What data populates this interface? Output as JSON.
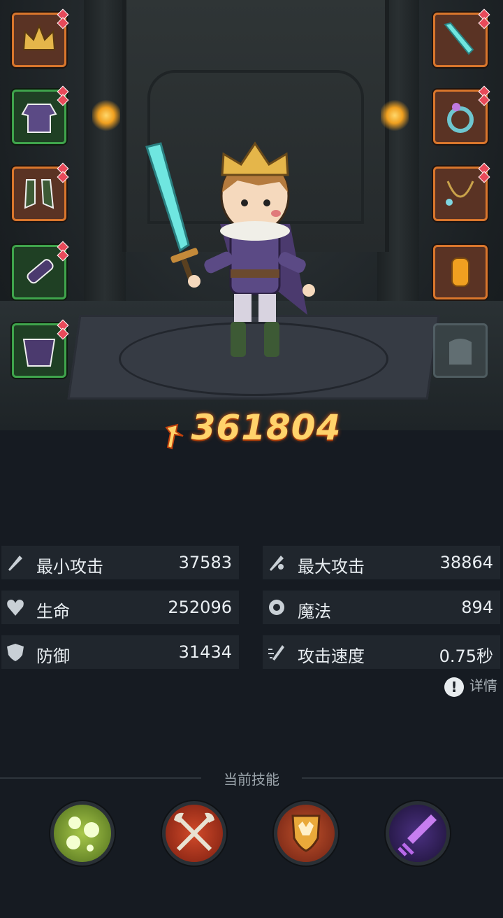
{
  "power": {
    "value": "361804",
    "icon": "sword-power-icon"
  },
  "equipment": {
    "left": [
      {
        "name": "helmet-slot",
        "icon": "crown-helmet-icon",
        "rarity": "orange"
      },
      {
        "name": "armor-slot",
        "icon": "tunic-armor-icon",
        "rarity": "green"
      },
      {
        "name": "boots-slot",
        "icon": "boots-icon",
        "rarity": "orange"
      },
      {
        "name": "gloves-slot",
        "icon": "bracer-icon",
        "rarity": "green"
      },
      {
        "name": "cape-slot",
        "icon": "cape-icon",
        "rarity": "green"
      }
    ],
    "right": [
      {
        "name": "weapon-slot",
        "icon": "crystal-sword-icon",
        "rarity": "orange"
      },
      {
        "name": "ring-slot",
        "icon": "ring-icon",
        "rarity": "orange"
      },
      {
        "name": "necklace-slot",
        "icon": "necklace-icon",
        "rarity": "orange"
      },
      {
        "name": "bracelet-slot",
        "icon": "gold-bracelet-icon",
        "rarity": "orange"
      },
      {
        "name": "pet-slot",
        "icon": "pet-silhouette-icon",
        "rarity": "empty"
      }
    ]
  },
  "stats": [
    {
      "label": "最小攻击",
      "value": "37583",
      "icon": "min-attack-icon"
    },
    {
      "label": "最大攻击",
      "value": "38864",
      "icon": "max-attack-icon"
    },
    {
      "label": "生命",
      "value": "252096",
      "icon": "heart-icon"
    },
    {
      "label": "魔法",
      "value": "894",
      "icon": "magic-icon"
    },
    {
      "label": "防御",
      "value": "31434",
      "icon": "shield-icon"
    },
    {
      "label": "攻击速度",
      "value": "0.75秒",
      "icon": "attack-speed-icon"
    }
  ],
  "detail_label": "详情",
  "skills": {
    "title": "当前技能",
    "items": [
      {
        "icon": "poison-bubbles-icon",
        "color": "#6f9a2a"
      },
      {
        "icon": "crossed-axes-icon",
        "color": "#b8361e"
      },
      {
        "icon": "crest-shield-icon",
        "color": "#a23a22"
      },
      {
        "icon": "purple-sword-icon",
        "color": "#3a2460"
      }
    ]
  },
  "colors": {
    "power": "#ffd36b",
    "rarity_orange": "#d9762c",
    "rarity_green": "#3fa44c",
    "panel": "#20262d"
  }
}
